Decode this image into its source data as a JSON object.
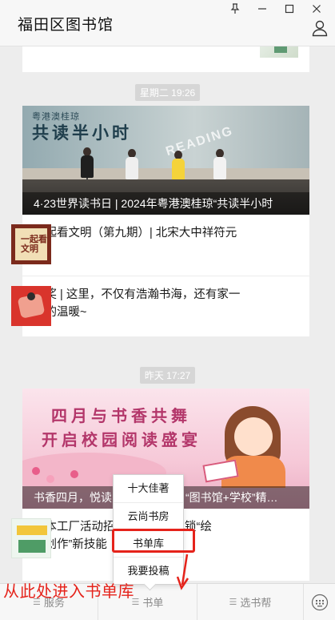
{
  "header": {
    "title": "福田区图书馆",
    "window_controls": [
      "pin-icon",
      "minimize-icon",
      "maximize-icon",
      "close-icon"
    ],
    "account_icon": "user-icon"
  },
  "feed": {
    "groups": [
      {
        "timestamp": "星期二 19:26",
        "hero_caption": "4·23世界读书日 | 2024年粤港澳桂琼“共读半小时",
        "hero_art": {
          "line1": "粤港澳桂琼",
          "line2": "共读半小时",
          "word": "READING"
        },
        "articles": [
          {
            "title": "一起看文明（第九期）| 北宋大中祥符元年",
            "thumb_text": "一起看文明"
          },
          {
            "title": "获奖 | 这里，不仅有浩瀚书海，还有家一般的温暖~"
          }
        ]
      },
      {
        "timestamp": "昨天 17:27",
        "hero_caption": "书香四月，悦读",
        "hero_caption_tail": "“图书馆+学校”精…",
        "hero_art": {
          "line1": "四月与书香共舞",
          "line2": "开启校园阅读盛宴"
        },
        "articles": [
          {
            "title_head": "绘本工厂活动招",
            "title_tail": "带你解锁“绘",
            "title_line2_head": "本创作”新技能"
          }
        ]
      }
    ]
  },
  "popup_menu": {
    "items": [
      "十大佳著",
      "云尚书房",
      "书单库",
      "我要投稿"
    ],
    "highlighted_index": 2
  },
  "annotation": {
    "text": "从此处进入书单库",
    "color": "#e5231b"
  },
  "menu_bar": {
    "tabs": [
      "服务",
      "书单",
      "选书帮"
    ],
    "keyboard_icon": "keyboard-icon"
  },
  "colors": {
    "background": "#ededed",
    "accent_red": "#e5231b",
    "menu_text": "#8a8a8a"
  }
}
